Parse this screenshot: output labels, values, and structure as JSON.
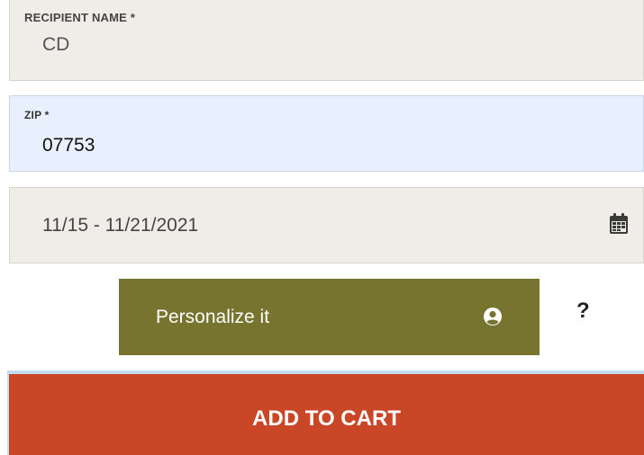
{
  "form": {
    "recipient_name": {
      "label": "RECIPIENT NAME *",
      "value": "CD"
    },
    "zip": {
      "label": "ZIP *",
      "value": "07753"
    },
    "date_range": {
      "value": "11/15 - 11/21/2021",
      "icon": "calendar-icon"
    }
  },
  "actions": {
    "personalize_label": "Personalize it",
    "personalize_icon": "user-circle-icon",
    "help_label": "?",
    "add_to_cart_label": "ADD TO CART"
  },
  "colors": {
    "personalize_bg": "#76742f",
    "add_to_cart_bg": "#c94727",
    "field_bg": "#efede8",
    "focused_field_bg": "#e8f0fe"
  }
}
